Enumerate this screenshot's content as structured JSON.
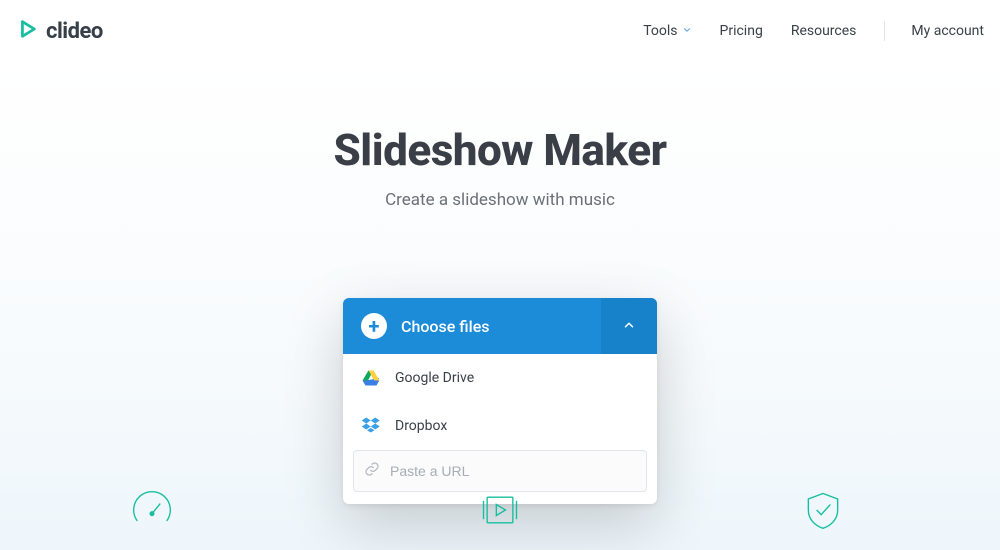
{
  "header": {
    "brand": "clideo",
    "nav": [
      "Tools",
      "Pricing",
      "Resources"
    ],
    "account": "My account"
  },
  "hero": {
    "title": "Slideshow Maker",
    "subtitle": "Create a slideshow with music"
  },
  "panel": {
    "choose_label": "Choose files",
    "sources": [
      "Google Drive",
      "Dropbox"
    ],
    "url_placeholder": "Paste a URL"
  },
  "colors": {
    "accent_teal": "#17bfa0",
    "accent_blue": "#1c8cd8"
  }
}
